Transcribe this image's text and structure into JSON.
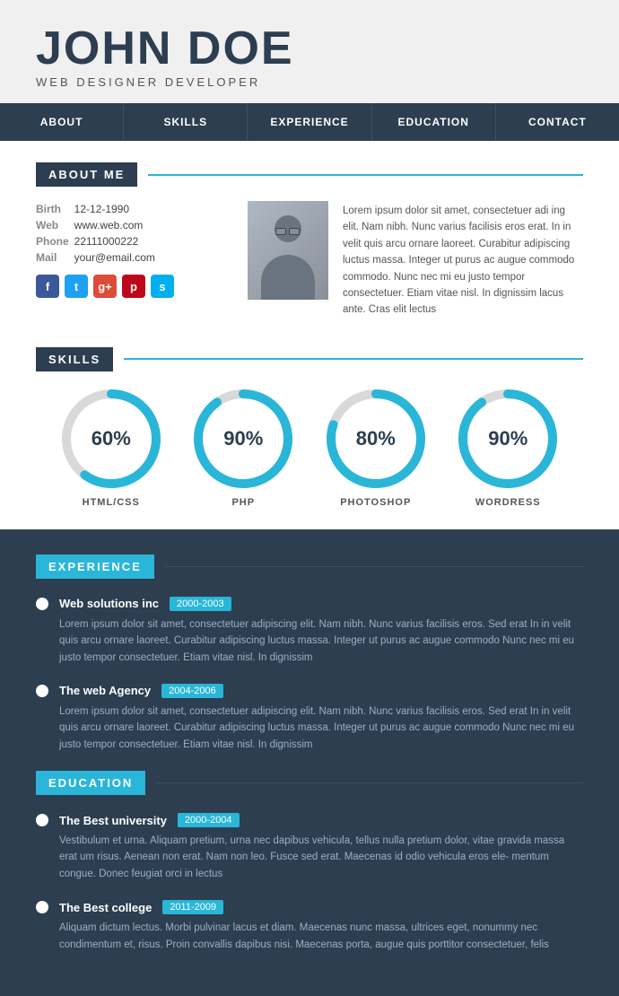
{
  "header": {
    "name": "JOHN DOE",
    "title": "WEB DESIGNER DEVELOPER"
  },
  "nav": {
    "items": [
      "ABOUT",
      "SKILLS",
      "EXPERIENCE",
      "EDUCATION",
      "CONTACT"
    ]
  },
  "about": {
    "section_title": "ABOUT ME",
    "info": {
      "birth_label": "Birth",
      "birth_value": "12-12-1990",
      "web_label": "Web",
      "web_value": "www.web.com",
      "phone_label": "Phone",
      "phone_value": "22111000222",
      "mail_label": "Mail",
      "mail_value": "your@email.com"
    },
    "bio": "Lorem ipsum dolor sit amet, consectetuer adi ing elit. Nam nibh. Nunc varius facilisis eros erat. In in velit quis arcu ornare laoreet. Curabitur adipiscing luctus massa. Integer ut purus ac augue commodo commodo. Nunc nec mi eu justo tempor consectetuer. Etiam vitae nisl. In dignissim lacus ante. Cras elit lectus"
  },
  "skills": {
    "section_title": "SKILLS",
    "items": [
      {
        "name": "HTML/CSS",
        "percent": 60
      },
      {
        "name": "PHP",
        "percent": 90
      },
      {
        "name": "PHOTOSHOP",
        "percent": 80
      },
      {
        "name": "WORDRESS",
        "percent": 90
      }
    ]
  },
  "experience": {
    "section_title": "EXPERIENCE",
    "items": [
      {
        "company": "Web solutions inc",
        "years": "2000-2003",
        "desc": "Lorem ipsum dolor sit amet, consectetuer adipiscing elit. Nam nibh. Nunc varius facilisis eros. Sed erat In in velit quis arcu ornare laoreet. Curabitur adipiscing luctus massa. Integer ut purus ac augue commodo Nunc nec mi eu justo tempor consectetuer. Etiam vitae nisl. In dignissim"
      },
      {
        "company": "The web Agency",
        "years": "2004-2006",
        "desc": "Lorem ipsum dolor sit amet, consectetuer adipiscing elit. Nam nibh. Nunc varius facilisis eros. Sed erat In in velit quis arcu ornare laoreet. Curabitur adipiscing luctus massa. Integer ut purus ac augue commodo Nunc nec mi eu justo tempor consectetuer. Etiam vitae nisl. In dignissim"
      }
    ]
  },
  "education": {
    "section_title": "EDUCATION",
    "items": [
      {
        "school": "The Best university",
        "years": "2000-2004",
        "desc": "Vestibulum et urna. Aliquam pretium, urna nec dapibus vehicula, tellus nulla pretium dolor, vitae gravida massa erat um risus. Aenean non erat. Nam non leo. Fusce sed erat. Maecenas id odio vehicula eros ele- mentum congue. Donec feugiat orci in lectus"
      },
      {
        "school": "The Best college",
        "years": "2011-2009",
        "desc": "Aliquam dictum lectus. Morbi pulvinar lacus et diam. Maecenas nunc massa, ultrices eget, nonummy nec condimentum et, risus. Proin convallis dapibus nisi. Maecenas porta, augue quis porttitor consectetuer, felis"
      }
    ]
  },
  "colors": {
    "dark_bg": "#2c3e50",
    "accent_blue": "#29b6d8",
    "light_gray": "#9bb0c5",
    "donut_track": "#d9d9d9",
    "donut_fill": "#29b6d8"
  }
}
